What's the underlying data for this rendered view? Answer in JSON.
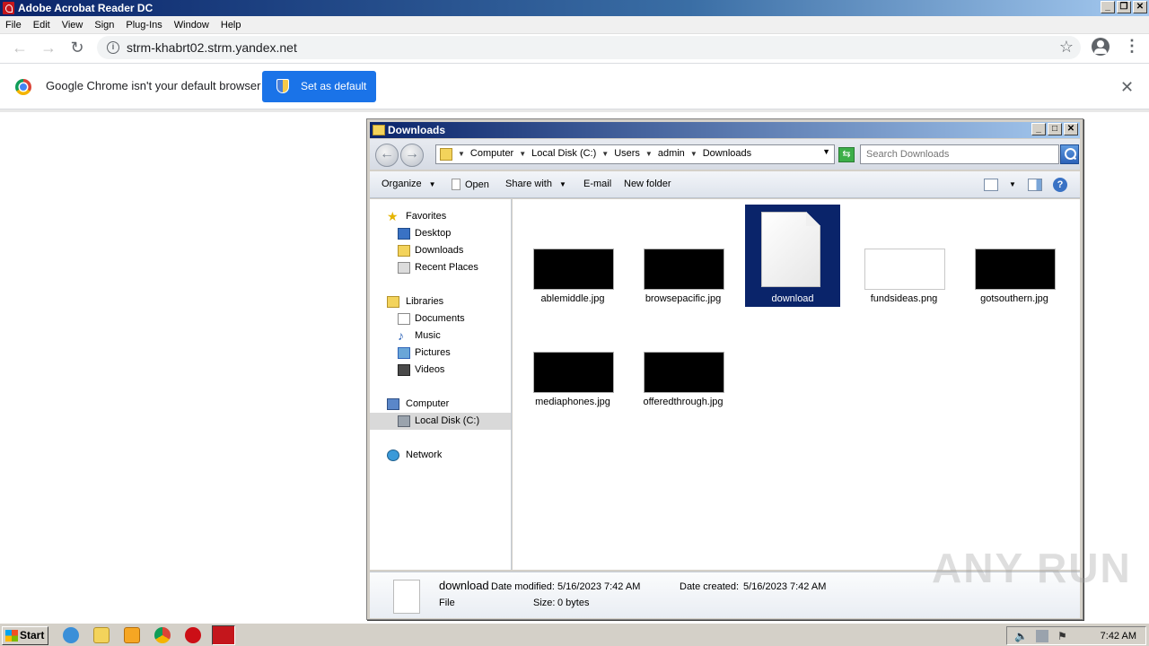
{
  "app": {
    "title": "Adobe Acrobat Reader DC"
  },
  "menu": [
    "File",
    "Edit",
    "View",
    "Sign",
    "Plug-Ins",
    "Window",
    "Help"
  ],
  "chrome": {
    "url": "strm-khabrt02.strm.yandex.net",
    "infobar_text": "Google Chrome isn't your default browser",
    "set_default_label": "Set as default"
  },
  "explorer": {
    "title": "Downloads",
    "breadcrumbs": [
      "Computer",
      "Local Disk (C:)",
      "Users",
      "admin",
      "Downloads"
    ],
    "search_placeholder": "Search Downloads",
    "commands": {
      "organize": "Organize",
      "open": "Open",
      "share_with": "Share with",
      "email": "E-mail",
      "new_folder": "New folder"
    },
    "nav": {
      "favorites": "Favorites",
      "desktop": "Desktop",
      "downloads": "Downloads",
      "recent_places": "Recent Places",
      "libraries": "Libraries",
      "documents": "Documents",
      "music": "Music",
      "pictures": "Pictures",
      "videos": "Videos",
      "computer": "Computer",
      "local_disk": "Local Disk (C:)",
      "network": "Network"
    },
    "files": [
      {
        "name": "ablemiddle.jpg"
      },
      {
        "name": "browsepacific.jpg"
      },
      {
        "name": "download"
      },
      {
        "name": "fundsideas.png"
      },
      {
        "name": "gotsouthern.jpg"
      },
      {
        "name": "mediaphones.jpg"
      },
      {
        "name": "offeredthrough.jpg"
      }
    ],
    "details": {
      "name": "download",
      "type": "File",
      "date_modified_label": "Date modified:",
      "date_modified": "5/16/2023 7:42 AM",
      "date_created_label": "Date created:",
      "date_created": "5/16/2023 7:42 AM",
      "size_label": "Size:",
      "size": "0 bytes"
    }
  },
  "taskbar": {
    "start_label": "Start",
    "clock": "7:42 AM"
  },
  "watermark": "ANY RUN"
}
